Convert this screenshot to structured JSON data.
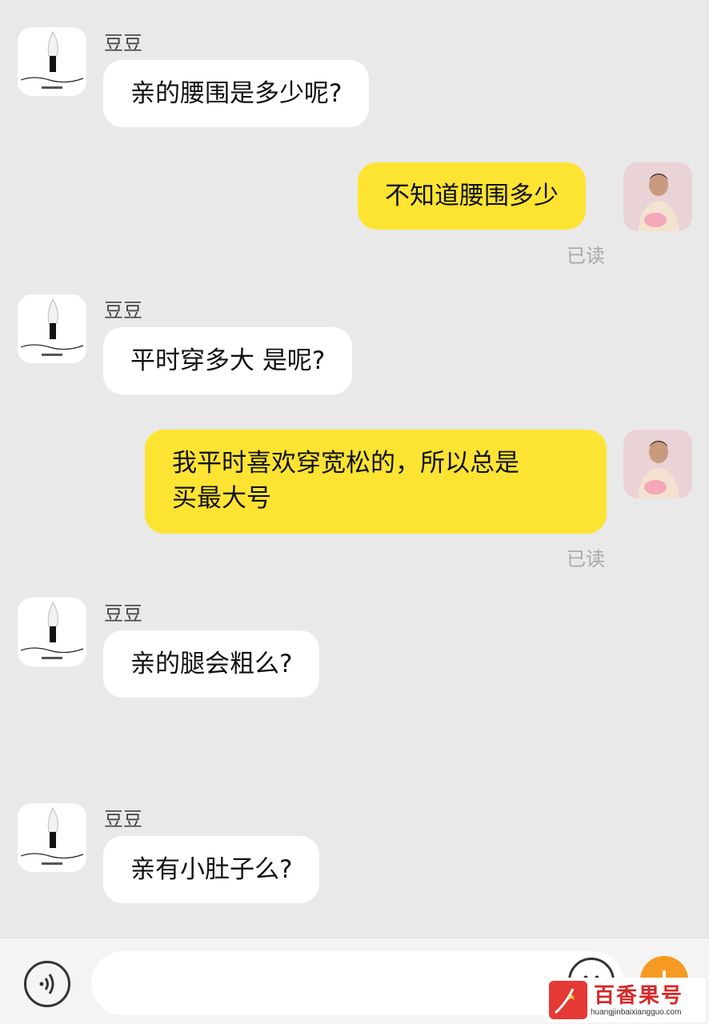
{
  "messages": [
    {
      "side": "left",
      "sender": "豆豆",
      "text": "亲的腰围是多少呢?",
      "avatar": "knife-logo-avatar"
    },
    {
      "side": "right",
      "text": "不知道腰围多少",
      "status": "已读",
      "avatar": "user-photo-avatar"
    },
    {
      "side": "left",
      "sender": "豆豆",
      "text": "平时穿多大 是呢?",
      "avatar": "knife-logo-avatar"
    },
    {
      "side": "right",
      "text_lines": [
        "我平时喜欢穿宽松的，所以总是",
        "买最大号"
      ],
      "status": "已读",
      "avatar": "user-photo-avatar"
    },
    {
      "side": "left",
      "sender": "豆豆",
      "text": "亲的腿会粗么?",
      "avatar": "knife-logo-avatar"
    },
    {
      "side": "left",
      "sender": "豆豆",
      "text": "亲有小肚子么?",
      "avatar": "knife-logo-avatar"
    }
  ],
  "input_bar": {
    "voice_icon": "voice-icon",
    "emoji_icon": "emoji-icon",
    "plus_icon": "plus-icon"
  },
  "watermark": {
    "title": "百香果号",
    "url": "huangjinbaixiangguo.com"
  },
  "colors": {
    "background": "#e9e9e9",
    "self_bubble": "#fde432",
    "other_bubble": "#ffffff",
    "accent": "#f59a23"
  }
}
